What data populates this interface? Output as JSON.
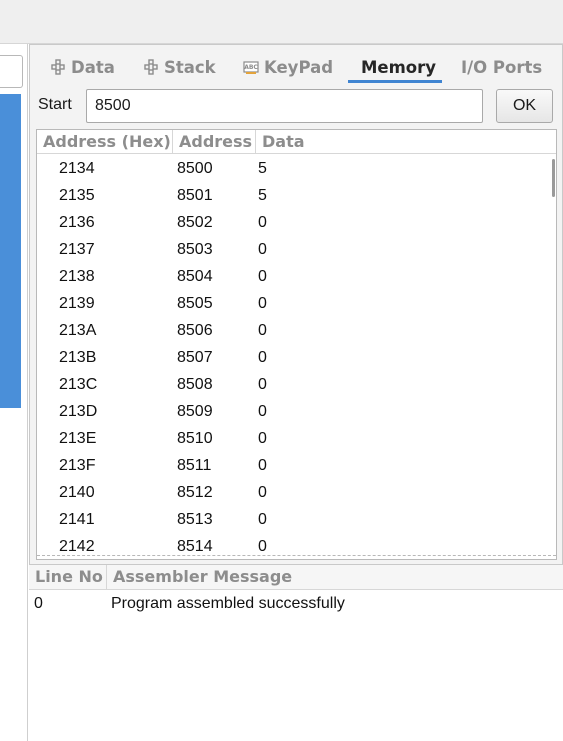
{
  "tabs": [
    {
      "label": "Data",
      "icon": "grid-icon",
      "active": false
    },
    {
      "label": "Stack",
      "icon": "grid-icon",
      "active": false
    },
    {
      "label": "KeyPad",
      "icon": "keypad-icon",
      "active": false
    },
    {
      "label": "Memory",
      "icon": "",
      "active": true
    },
    {
      "label": "I/O Ports",
      "icon": "",
      "active": false
    }
  ],
  "start": {
    "label": "Start",
    "value": "8500",
    "ok_label": "OK"
  },
  "memory_table": {
    "headers": [
      "Address (Hex)",
      "Address",
      "Data"
    ],
    "rows": [
      [
        "2134",
        "8500",
        "5"
      ],
      [
        "2135",
        "8501",
        "5"
      ],
      [
        "2136",
        "8502",
        "0"
      ],
      [
        "2137",
        "8503",
        "0"
      ],
      [
        "2138",
        "8504",
        "0"
      ],
      [
        "2139",
        "8505",
        "0"
      ],
      [
        "213A",
        "8506",
        "0"
      ],
      [
        "213B",
        "8507",
        "0"
      ],
      [
        "213C",
        "8508",
        "0"
      ],
      [
        "213D",
        "8509",
        "0"
      ],
      [
        "213E",
        "8510",
        "0"
      ],
      [
        "213F",
        "8511",
        "0"
      ],
      [
        "2140",
        "8512",
        "0"
      ],
      [
        "2141",
        "8513",
        "0"
      ],
      [
        "2142",
        "8514",
        "0"
      ]
    ]
  },
  "log": {
    "headers": [
      "Line No",
      "Assembler Message"
    ],
    "rows": [
      [
        "0",
        "Program assembled successfully"
      ]
    ]
  },
  "colors": {
    "accent": "#3f84d1",
    "left_panel": "#4a8fd9"
  }
}
